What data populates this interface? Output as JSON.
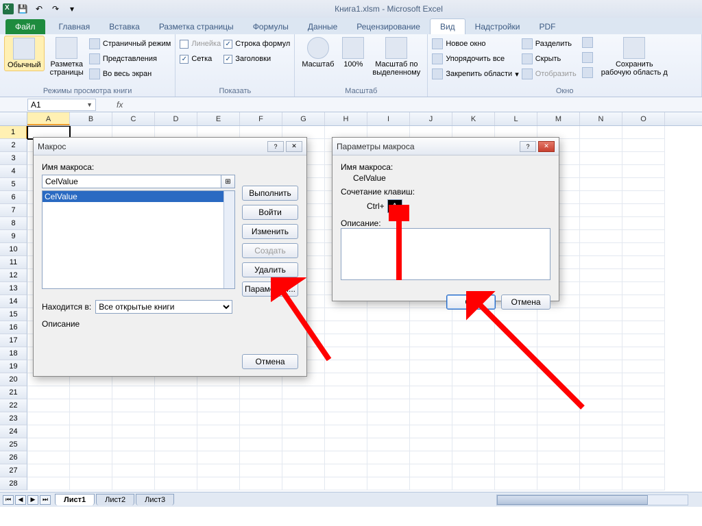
{
  "titlebar": {
    "title": "Книга1.xlsm  -  Microsoft Excel"
  },
  "ribbon": {
    "file": "Файл",
    "tabs": [
      "Главная",
      "Вставка",
      "Разметка страницы",
      "Формулы",
      "Данные",
      "Рецензирование",
      "Вид",
      "Надстройки",
      "PDF"
    ],
    "active_tab": "Вид",
    "groups": {
      "views": {
        "label": "Режимы просмотра книги",
        "normal": "Обычный",
        "page_layout": "Разметка\nстраницы",
        "page_break": "Страничный режим",
        "custom": "Представления",
        "full": "Во весь экран"
      },
      "show": {
        "label": "Показать",
        "ruler": "Линейка",
        "gridlines": "Сетка",
        "formulabar": "Строка формул",
        "headings": "Заголовки"
      },
      "zoom": {
        "label": "Масштаб",
        "zoom": "Масштаб",
        "hundred": "100%",
        "selection": "Масштаб по\nвыделенному"
      },
      "window": {
        "label": "Окно",
        "new": "Новое окно",
        "arrange": "Упорядочить все",
        "freeze": "Закрепить области",
        "split": "Разделить",
        "hide": "Скрыть",
        "unhide": "Отобразить",
        "save_ws": "Сохранить\nрабочую область д"
      }
    }
  },
  "formula_bar": {
    "name_box": "A1",
    "fx": "fx"
  },
  "columns": [
    "A",
    "B",
    "C",
    "D",
    "E",
    "F",
    "G",
    "H",
    "I",
    "J",
    "K",
    "L",
    "M",
    "N",
    "O"
  ],
  "row_count": 28,
  "sheets": {
    "active": "Лист1",
    "others": [
      "Лист2",
      "Лист3"
    ]
  },
  "macro_dialog": {
    "title": "Макрос",
    "name_label": "Имя макроса:",
    "name_value": "CelValue",
    "list_selected": "CelValue",
    "run": "Выполнить",
    "step": "Войти",
    "edit": "Изменить",
    "create": "Создать",
    "delete": "Удалить",
    "options": "Параметры...",
    "in_label": "Находится в:",
    "in_value": "Все открытые книги",
    "desc_label": "Описание",
    "cancel": "Отмена"
  },
  "params_dialog": {
    "title": "Параметры макроса",
    "name_label": "Имя макроса:",
    "name_value": "CelValue",
    "shortcut_label": "Сочетание клавиш:",
    "ctrl": "Ctrl+",
    "key": "A",
    "desc_label": "Описание:",
    "ok": "OK",
    "cancel": "Отмена"
  }
}
